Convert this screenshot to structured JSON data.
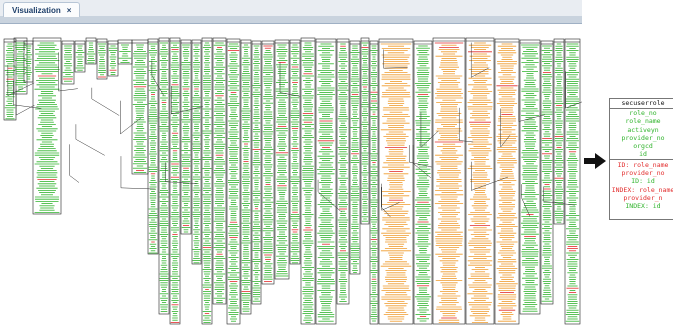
{
  "tab": {
    "label": "Visualization",
    "close": "×"
  },
  "colors": {
    "primary": "#2fb32b",
    "index": "#e22b2b",
    "foreign": "#ef9a2a",
    "border": "#222222"
  },
  "zoomed_table": {
    "title": "secuserrole",
    "columns": [
      "role_no",
      "role_name",
      "activeyn",
      "provider_no",
      "orgcd",
      "id"
    ],
    "indexes": [
      "ID: role_name",
      "provider_no",
      "ID: id",
      "INDEX: role_name",
      "provider_n",
      "INDEX: id"
    ]
  },
  "icons": {
    "pointer": "arrow-right-icon",
    "close": "close-icon"
  }
}
